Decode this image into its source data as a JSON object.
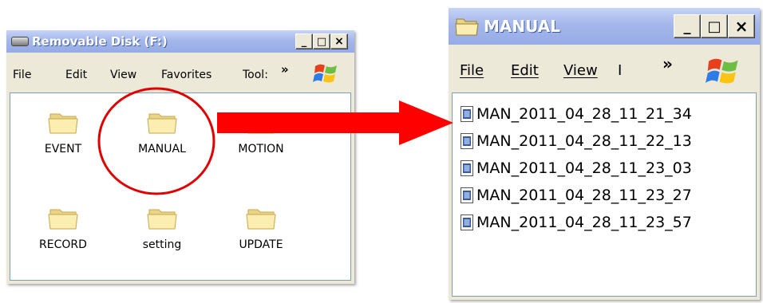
{
  "left_window": {
    "title": "Removable Disk (F:)",
    "menu": [
      "File",
      "Edit",
      "View",
      "Favorites",
      "Tool:"
    ],
    "chevron": "»",
    "folders": [
      {
        "label": "EVENT",
        "icon": "folder-icon"
      },
      {
        "label": "MANUAL",
        "icon": "folder-icon"
      },
      {
        "label": "MOTION",
        "icon": "folder-icon"
      },
      {
        "label": "RECORD",
        "icon": "folder-icon"
      },
      {
        "label": "setting",
        "icon": "folder-icon"
      },
      {
        "label": "UPDATE",
        "icon": "folder-icon"
      }
    ],
    "caption_buttons": [
      "_",
      "□",
      "×"
    ]
  },
  "right_window": {
    "title": "MANUAL",
    "menu": [
      "File",
      "Edit",
      "View",
      "I"
    ],
    "chevron": "»",
    "files": [
      "MAN_2011_04_28_11_21_34",
      "MAN_2011_04_28_11_22_13",
      "MAN_2011_04_28_11_23_03",
      "MAN_2011_04_28_11_23_27",
      "MAN_2011_04_28_11_23_57"
    ],
    "caption_buttons": [
      "_",
      "□",
      "×"
    ]
  },
  "annotation": {
    "circle_color": "#e00000",
    "arrow_color": "#ff0000"
  }
}
